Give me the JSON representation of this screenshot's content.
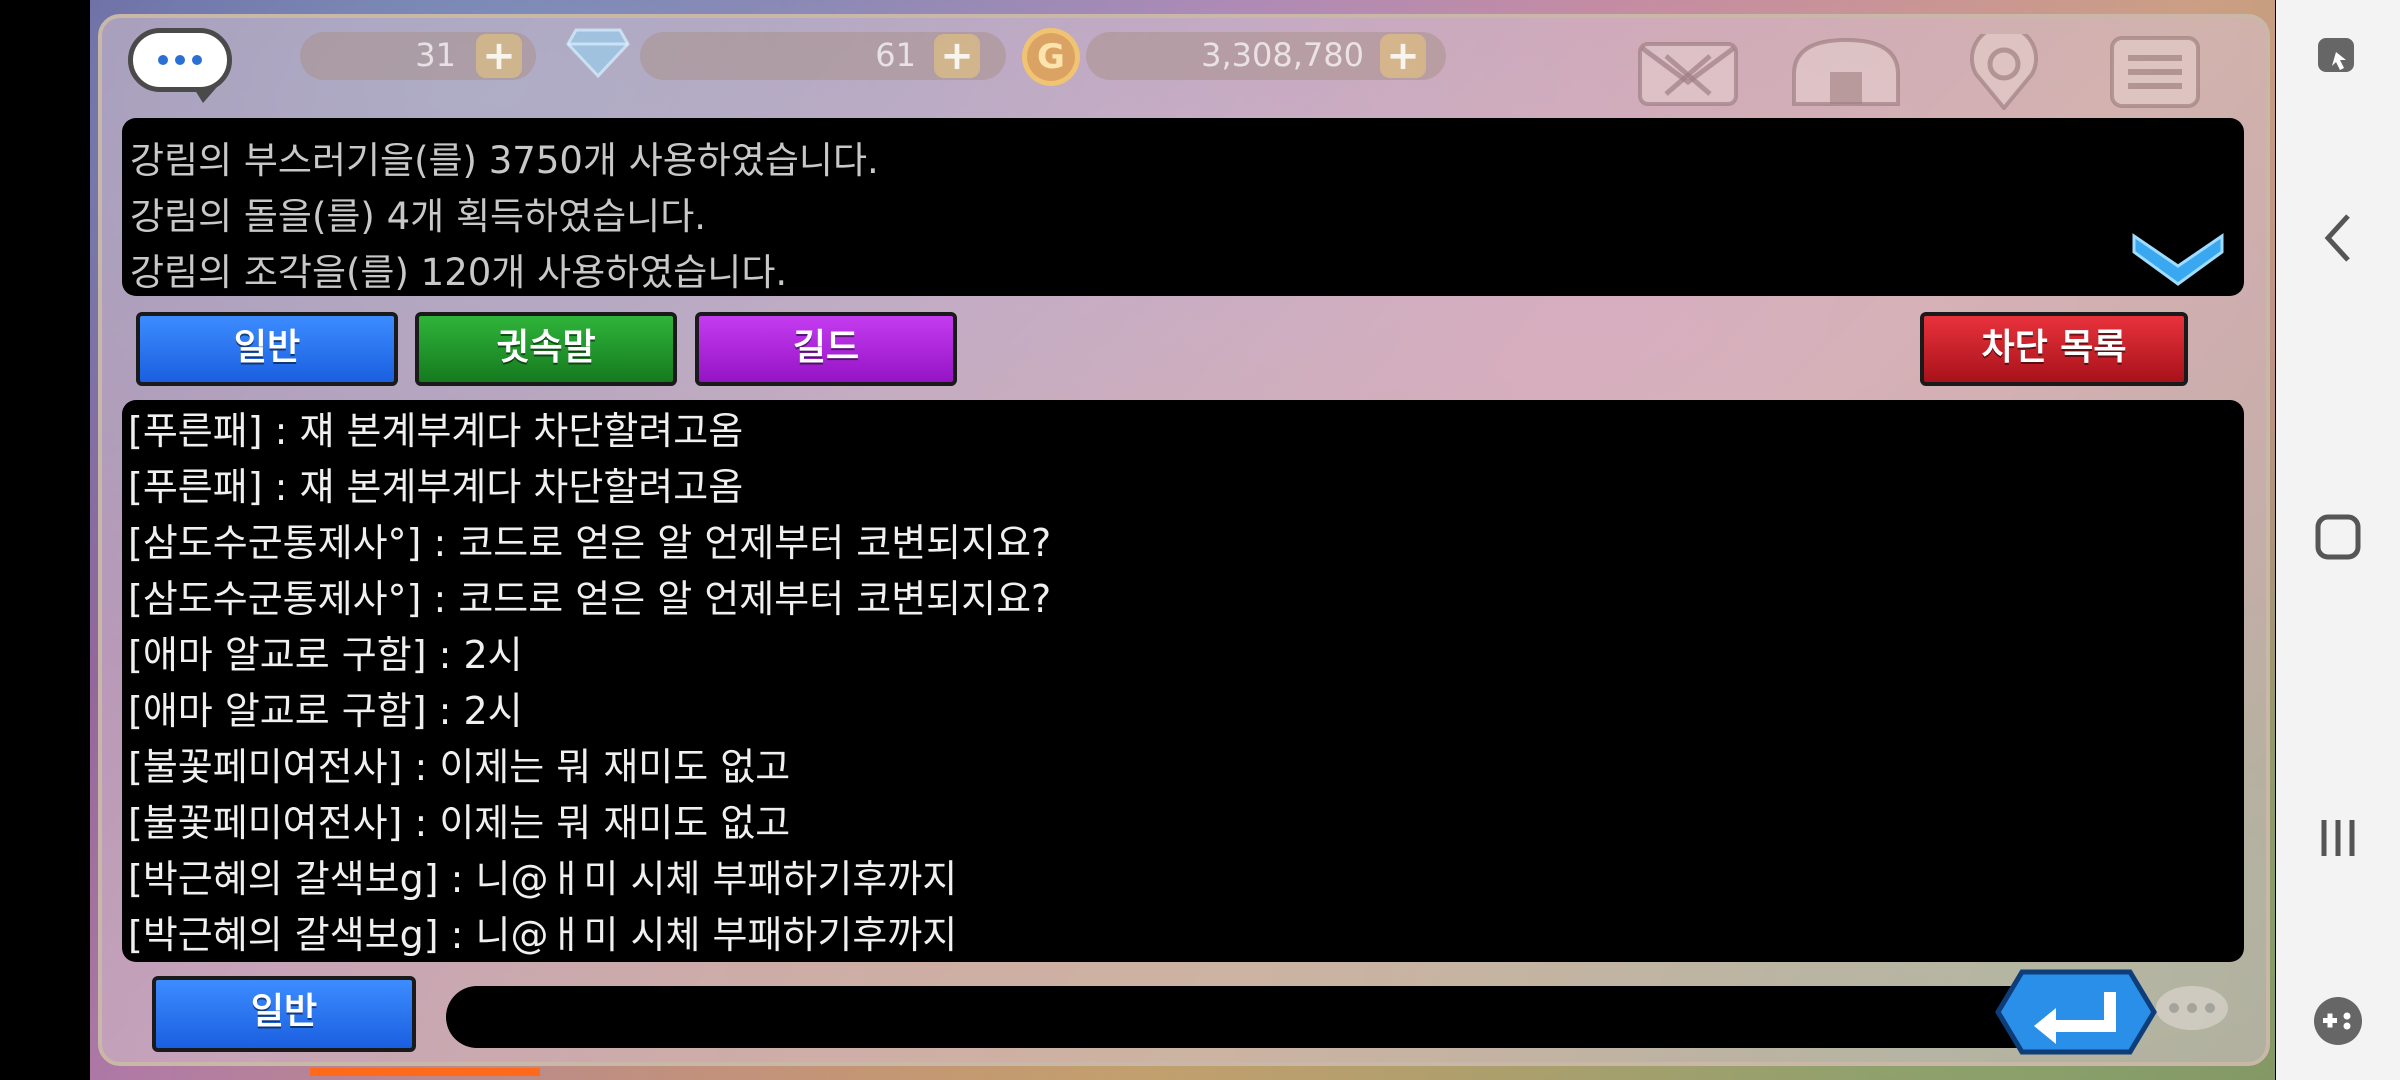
{
  "topbar": {
    "currency1_value": "31",
    "currency2_value": "61",
    "gold_value": "3,308,780",
    "plus_label": "+",
    "coin_symbol": "G",
    "icons": [
      "chat-bubble-icon",
      "gem-icon",
      "coin-icon",
      "mail-icon",
      "shop-icon",
      "settings-icon",
      "menu-icon"
    ]
  },
  "system_messages": [
    "강림의 부스러기을(를) 3750개 사용하였습니다.",
    "강림의 돌을(를) 4개 획득하였습니다.",
    "강림의 조각을(를) 120개 사용하였습니다."
  ],
  "tabs": {
    "general": "일반",
    "whisper": "귓속말",
    "guild": "길드",
    "block_list": "차단 목록"
  },
  "chat_log": [
    "[푸른패] : 쟤 본계부계다 차단할려고옴",
    "[푸른패] : 쟤 본계부계다 차단할려고옴",
    "[삼도수군통제사°] : 코드로 얻은 알 언제부터 코변되지요?",
    "[삼도수군통제사°] : 코드로 얻은 알 언제부터 코변되지요?",
    "[애마 알교로 구함] : 2시",
    "[애마 알교로 구함] : 2시",
    "[불꽃페미여전사] : 이제는 뭐 재미도 없고",
    "[불꽃페미여전사] : 이제는 뭐 재미도 없고",
    "[박근혜의 갈색보g] : 니@ㅐ미 시체 부패하기후까지",
    "[박근혜의 갈색보g] : 니@ㅐ미 시체 부패하기후까지"
  ],
  "input": {
    "channel_label": "일반",
    "value": ""
  },
  "colors": {
    "tab_general": "#1a5fe0",
    "tab_whisper": "#157a1f",
    "tab_guild": "#9414c4",
    "tab_block": "#a8121a",
    "send_button": "#2a8fe8"
  }
}
